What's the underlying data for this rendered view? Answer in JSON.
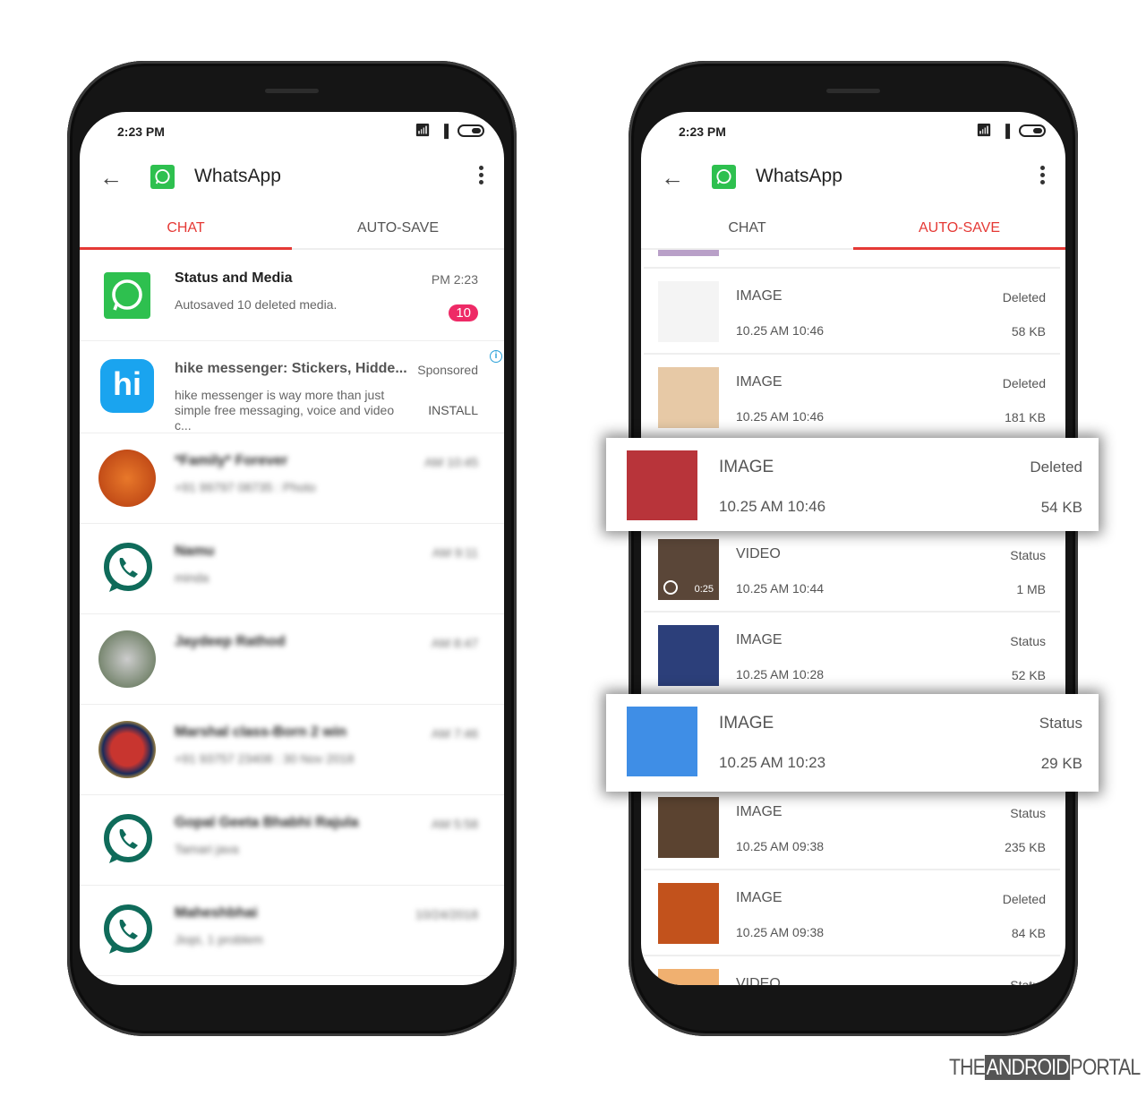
{
  "status_bar": {
    "time": "2:23 PM"
  },
  "app_bar": {
    "title": "WhatsApp",
    "back_icon": "arrow-left-icon",
    "menu_icon": "more-vertical-icon"
  },
  "tabs": [
    "CHAT",
    "AUTO-SAVE"
  ],
  "colors": {
    "accent": "#e53935",
    "whatsapp_green": "#2ec04f",
    "badge": "#ee2a66",
    "hike_blue": "#1aa4ef"
  },
  "chat_list": [
    {
      "name": "Status and Media",
      "time": "PM 2:23",
      "message": "Autosaved 10 deleted media.",
      "badge": "10",
      "avatar": "whatsapp-square"
    },
    {
      "name": "hike messenger: Stickers, Hidde...",
      "time": "Sponsored",
      "message": "hike messenger is way more than just simple free messaging, voice and video c...",
      "action": "INSTALL",
      "avatar": "hike-logo"
    },
    {
      "name": "*Family* Forever",
      "time": "AM 10:45",
      "message": "+91 99797 08735 : Photo",
      "blurred": true,
      "avatar": "photo-orange"
    },
    {
      "name": "Namu",
      "time": "AM 9:11",
      "message": "minda",
      "blurred": true,
      "avatar": "whatsapp-outline"
    },
    {
      "name": "Jaydeep Rathod",
      "time": "AM 8:47",
      "message": "",
      "blurred": true,
      "avatar": "photo-gray"
    },
    {
      "name": "Marshal class-Born 2 win",
      "time": "AM 7:46",
      "message": "+91 93757 23408 : 30 Nov 2018",
      "blurred": true,
      "avatar": "emblem"
    },
    {
      "name": "Gopal Geeta Bhabhi Rajula",
      "time": "AM 5:58",
      "message": "Tamari java",
      "blurred": true,
      "avatar": "whatsapp-outline"
    },
    {
      "name": "Maheshbhai",
      "time": "10/24/2018",
      "message": "Jiopi, 1 problem",
      "blurred": true,
      "avatar": "whatsapp-outline"
    }
  ],
  "autosave_list": [
    {
      "type": "IMAGE",
      "date": "10.25 AM 10:46",
      "state": "Deleted",
      "size": "58 KB",
      "thumb": "#f4f4f4"
    },
    {
      "type": "IMAGE",
      "date": "10.25 AM 10:46",
      "state": "Deleted",
      "size": "181 KB",
      "thumb": "#e7c9a6"
    },
    {
      "type": "IMAGE",
      "date": "10.25 AM 10:46",
      "state": "Deleted",
      "size": "54 KB",
      "thumb": "#b8343a",
      "highlighted": true
    },
    {
      "type": "VIDEO",
      "date": "10.25 AM 10:44",
      "state": "Status",
      "size": "1 MB",
      "thumb": "#5a4638",
      "duration": "0:25"
    },
    {
      "type": "IMAGE",
      "date": "10.25 AM 10:28",
      "state": "Status",
      "size": "52 KB",
      "thumb": "#2c3f7a"
    },
    {
      "type": "IMAGE",
      "date": "10.25 AM 10:23",
      "state": "Status",
      "size": "29 KB",
      "thumb": "#3f8ee6",
      "highlighted": true
    },
    {
      "type": "IMAGE",
      "date": "10.25 AM 09:38",
      "state": "Status",
      "size": "235 KB",
      "thumb": "#5b4330"
    },
    {
      "type": "IMAGE",
      "date": "10.25 AM 09:38",
      "state": "Deleted",
      "size": "84 KB",
      "thumb": "#c2521c"
    },
    {
      "type": "VIDEO",
      "date": "",
      "state": "Status",
      "size": "",
      "thumb": "#f0b070"
    }
  ],
  "watermark": {
    "pre": "THE",
    "mid": "ANDROID",
    "post": "PORTAL"
  }
}
